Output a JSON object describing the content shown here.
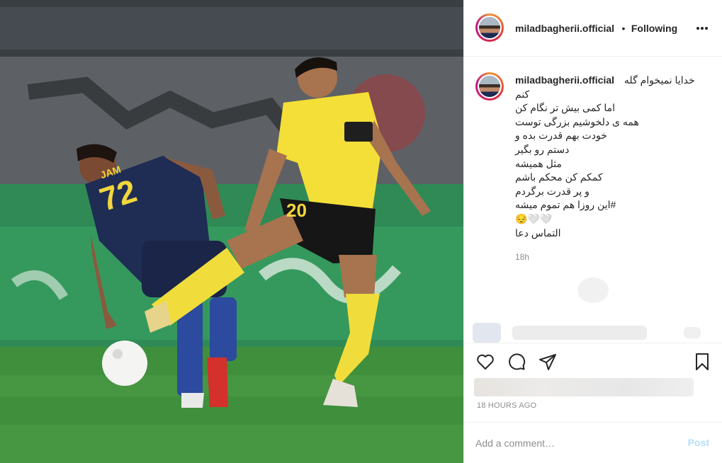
{
  "photo": {
    "player_left_number": "72",
    "player_left_name": "JAM",
    "player_right_number": "20"
  },
  "header": {
    "username": "miladbagherii.official",
    "separator": "•",
    "follow_status": "Following"
  },
  "caption": {
    "username": "miladbagherii.official",
    "lines": [
      "خدایا نمیخوام گله",
      "کنم",
      "اما کمی بیش تر نگام کن",
      "همه ی دلخوشیم بزرگی توست",
      "خودت بهم قدرت بده و",
      "دستم رو بگیر",
      "مثل همیشه",
      "کمکم کن محکم باشم",
      "و پر قدرت برگردم",
      "#این روزا هم تموم میشه",
      "😔🤍🤍",
      "التماس دعا"
    ],
    "time_ago": "18h"
  },
  "post": {
    "timestamp": "18 HOURS AGO"
  },
  "comment": {
    "placeholder": "Add a comment…",
    "post_label": "Post"
  },
  "icons": {
    "like": "heart-icon",
    "comment": "comment-icon",
    "share": "paper-plane-icon",
    "save": "bookmark-icon",
    "more": "more-horizontal-icon"
  },
  "colors": {
    "post_button": "#b2dffc",
    "muted_text": "#8e8e8e",
    "divider": "#efefef"
  }
}
